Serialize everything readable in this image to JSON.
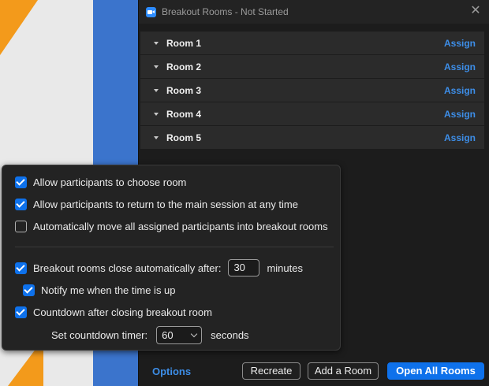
{
  "window": {
    "title": "Breakout Rooms - Not Started"
  },
  "rooms": [
    {
      "name": "Room 1",
      "action": "Assign"
    },
    {
      "name": "Room 2",
      "action": "Assign"
    },
    {
      "name": "Room 3",
      "action": "Assign"
    },
    {
      "name": "Room 4",
      "action": "Assign"
    },
    {
      "name": "Room 5",
      "action": "Assign"
    }
  ],
  "options_popup": {
    "allow_choose": {
      "label": "Allow participants to choose room",
      "checked": true
    },
    "allow_return": {
      "label": "Allow participants to return to the main session at any time",
      "checked": true
    },
    "auto_move": {
      "label": "Automatically move all assigned participants into breakout rooms",
      "checked": false
    },
    "auto_close": {
      "label": "Breakout rooms close automatically after:",
      "checked": true,
      "value": "30",
      "unit": "minutes"
    },
    "notify": {
      "label": "Notify me when the time is up",
      "checked": true
    },
    "countdown": {
      "label": "Countdown after closing breakout room",
      "checked": true
    },
    "countdown_timer": {
      "label": "Set countdown timer:",
      "value": "60",
      "unit": "seconds"
    }
  },
  "footer": {
    "options_label": "Options",
    "recreate_label": "Recreate",
    "add_room_label": "Add a Room",
    "open_all_label": "Open All Rooms"
  },
  "colors": {
    "accent": "#0e71eb",
    "link": "#3d8ee8",
    "panel": "#1c1c1c"
  }
}
